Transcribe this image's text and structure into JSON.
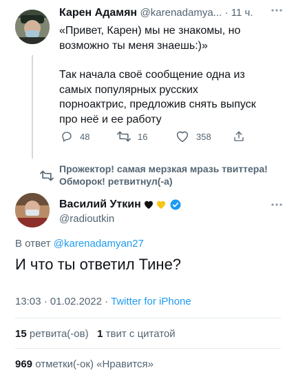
{
  "tweet1": {
    "author_name": "Карен Адамян",
    "author_handle": "@karenadamya...",
    "dot_time": "· 11 ч.",
    "text_line1": "«Привет, Карен) мы не знакомы, но",
    "text_line2": "возможно ты меня знаешь:)»",
    "text_line3": "Так начала своё сообщение одна из",
    "text_line4": "самых популярных русских",
    "text_line5": "порноактрис, предложив снять выпуск",
    "text_line6": "про неё и ее работу",
    "replies": "48",
    "retweets": "16",
    "likes": "358"
  },
  "retweet_note": {
    "line1": "Прожектор! самая мерзкая мразь твиттера!",
    "line2": "Обморок! ретвитнул(-а)"
  },
  "tweet2": {
    "author_name": "Василий Уткин",
    "author_handle": "@radioutkin",
    "reply_prefix": "В ответ",
    "reply_to": "@karenadamyan27",
    "text": "И что ты ответил Тине?",
    "timestamp": "13:03 · 01.02.2022 · ",
    "client": "Twitter for iPhone",
    "retweets_count": "15",
    "retweets_label": "ретвита(-ов)",
    "quotes_count": "1",
    "quotes_label": "твит с цитатой",
    "likes_count": "969",
    "likes_label": "отметки(-ок) «Нравится»"
  },
  "colors": {
    "accent": "#1d9bf0",
    "secondary_text": "#536471",
    "verified": "#1d9bf0"
  }
}
